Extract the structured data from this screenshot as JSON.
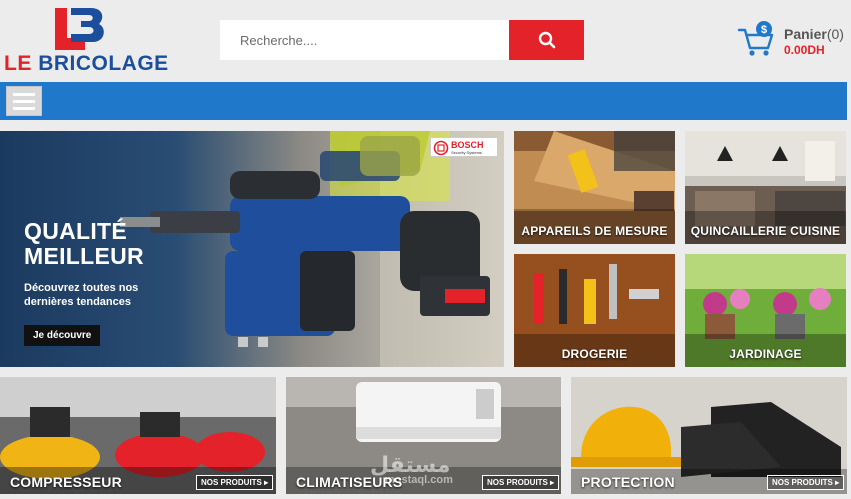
{
  "brand": {
    "logo_prefix": "LE",
    "logo_name": "BRICOLAGE",
    "colors": {
      "red": "#e4222a",
      "blue": "#1c4e9b",
      "nav": "#1f78c9"
    }
  },
  "search": {
    "placeholder": "Recherche....",
    "button_icon": "search-icon"
  },
  "cart": {
    "label": "Panier",
    "count": "(0)",
    "total": "0.00DH",
    "icon": "cart-icon"
  },
  "nav": {
    "menu_icon": "hamburger-icon"
  },
  "hero": {
    "title": "QUALITÉ\nMEILLEUR",
    "subtitle": "Découvrez toutes nos dernières tendances",
    "button": "Je découvre",
    "brand_badge": "BOSCH",
    "brand_badge_sub": "Security Systems",
    "slides": 2
  },
  "categories_small": [
    {
      "label": "APPAREILS DE MESURE"
    },
    {
      "label": "QUINCAILLERIE CUISINE"
    },
    {
      "label": "DROGERIE"
    },
    {
      "label": "JARDINAGE"
    }
  ],
  "categories_big": [
    {
      "label": "COMPRESSEUR",
      "button": "NOS PRODUITS ▸"
    },
    {
      "label": "CLIMATISEURS",
      "button": "NOS PRODUITS ▸"
    },
    {
      "label": "PROTECTION",
      "button": "NOS PRODUITS ▸"
    }
  ],
  "watermark": {
    "text": "مستقل",
    "sub": "mostaql.com"
  }
}
